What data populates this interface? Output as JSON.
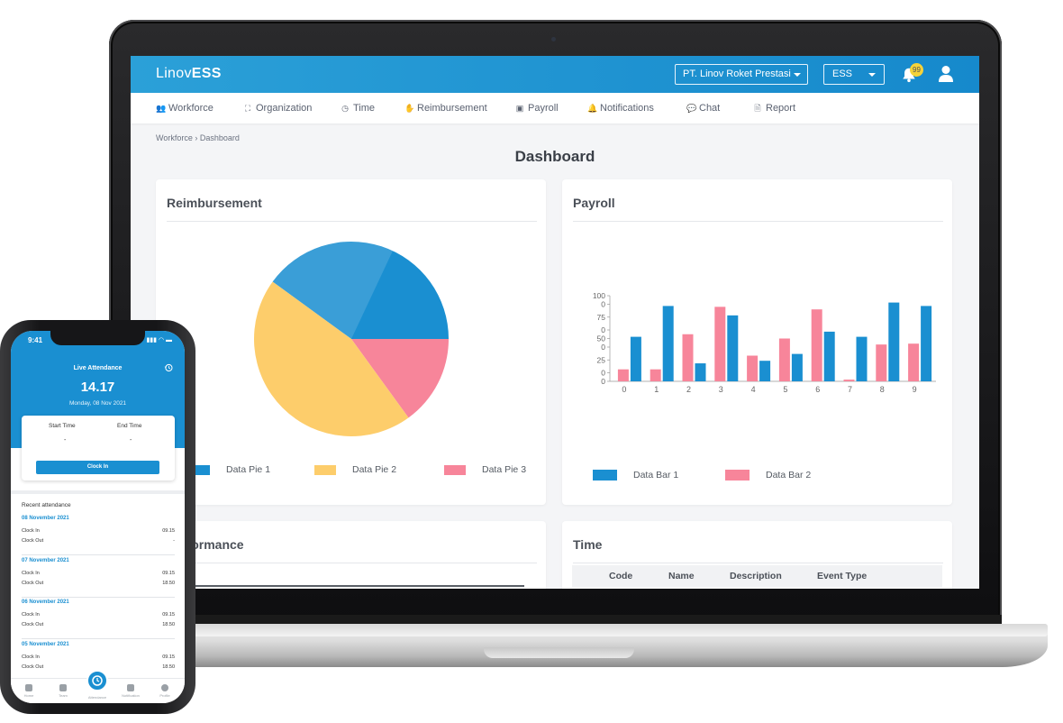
{
  "app": {
    "logo_light": "Linov",
    "logo_bold": "ESS",
    "company_select": "PT. Linov Roket Prestasi",
    "role_select": "ESS",
    "notification_count": "99"
  },
  "nav": {
    "items": [
      {
        "label": "Workforce",
        "icon": "users-icon"
      },
      {
        "label": "Organization",
        "icon": "sitemap-icon"
      },
      {
        "label": "Time",
        "icon": "clock-icon"
      },
      {
        "label": "Reimbursement",
        "icon": "hand-money-icon"
      },
      {
        "label": "Payroll",
        "icon": "money-bill-icon"
      },
      {
        "label": "Notifications",
        "icon": "bell-icon"
      },
      {
        "label": "Chat",
        "icon": "comments-icon"
      },
      {
        "label": "Report",
        "icon": "file-icon"
      }
    ]
  },
  "breadcrumb": {
    "parent": "Workforce",
    "separator": "›",
    "current": "Dashboard"
  },
  "page": {
    "title": "Dashboard"
  },
  "cards": {
    "reimbursement": {
      "title": "Reimbursement"
    },
    "payroll": {
      "title": "Payroll"
    },
    "performance": {
      "title": "Performance",
      "visible_title": "rformance"
    },
    "time": {
      "title": "Time",
      "columns": [
        "Code",
        "Name",
        "Description",
        "Event Type"
      ]
    }
  },
  "colors": {
    "brand": "#1a8fd1",
    "pie1": "#1a8fd1",
    "pie2": "#fdcd6b",
    "pie3": "#f7859a",
    "bar1": "#1a8fd1",
    "bar2": "#f7859a"
  },
  "chart_data": [
    {
      "type": "pie",
      "title": "Reimbursement",
      "legend": [
        "Data Pie 1",
        "Data Pie 2",
        "Data Pie 3"
      ],
      "legend_position": "bottom",
      "values": [
        40,
        45,
        15
      ],
      "series_colors": [
        "#1a8fd1",
        "#fdcd6b",
        "#f7859a"
      ]
    },
    {
      "type": "bar",
      "title": "Payroll",
      "categories": [
        "0",
        "1",
        "2",
        "3",
        "4",
        "5",
        "6",
        "7",
        "8",
        "9"
      ],
      "series": [
        {
          "name": "Data Bar 1",
          "values": [
            52,
            88,
            21,
            77,
            24,
            32,
            58,
            52,
            92,
            88
          ]
        },
        {
          "name": "Data Bar 2",
          "values": [
            14,
            14,
            55,
            87,
            30,
            50,
            84,
            2,
            43,
            44
          ]
        }
      ],
      "yticks": [
        0,
        10,
        25,
        40,
        50,
        60,
        75,
        90,
        100
      ],
      "ytick_labels": [
        "0",
        "0",
        "25",
        "0",
        "50",
        "0",
        "75",
        "0",
        "100"
      ],
      "ylim": [
        0,
        100
      ],
      "legend_position": "bottom"
    }
  ],
  "phone": {
    "status_time": "9:41",
    "status_icons": "▮▮▮ ◠ ▬",
    "title": "Live Attendance",
    "clock": "14.17",
    "date": "Monday, 08 Nov 2021",
    "start_label": "Start Time",
    "end_label": "End Time",
    "start_value": "-",
    "end_value": "-",
    "clock_in_button": "Clock In",
    "recent_title": "Recent attendance",
    "days": [
      {
        "date": "08 November 2021",
        "in_label": "Clock In",
        "in": "09.15",
        "out_label": "Clock Out",
        "out": "-"
      },
      {
        "date": "07 November 2021",
        "in_label": "Clock In",
        "in": "09.15",
        "out_label": "Clock Out",
        "out": "18.50"
      },
      {
        "date": "06 November 2021",
        "in_label": "Clock In",
        "in": "09.15",
        "out_label": "Clock Out",
        "out": "18.50"
      },
      {
        "date": "05 November 2021",
        "in_label": "Clock In",
        "in": "09.15",
        "out_label": "Clock Out",
        "out": "18.50"
      }
    ],
    "tabs": [
      "Home",
      "Team",
      "Attendance",
      "Notification",
      "Profile"
    ]
  }
}
